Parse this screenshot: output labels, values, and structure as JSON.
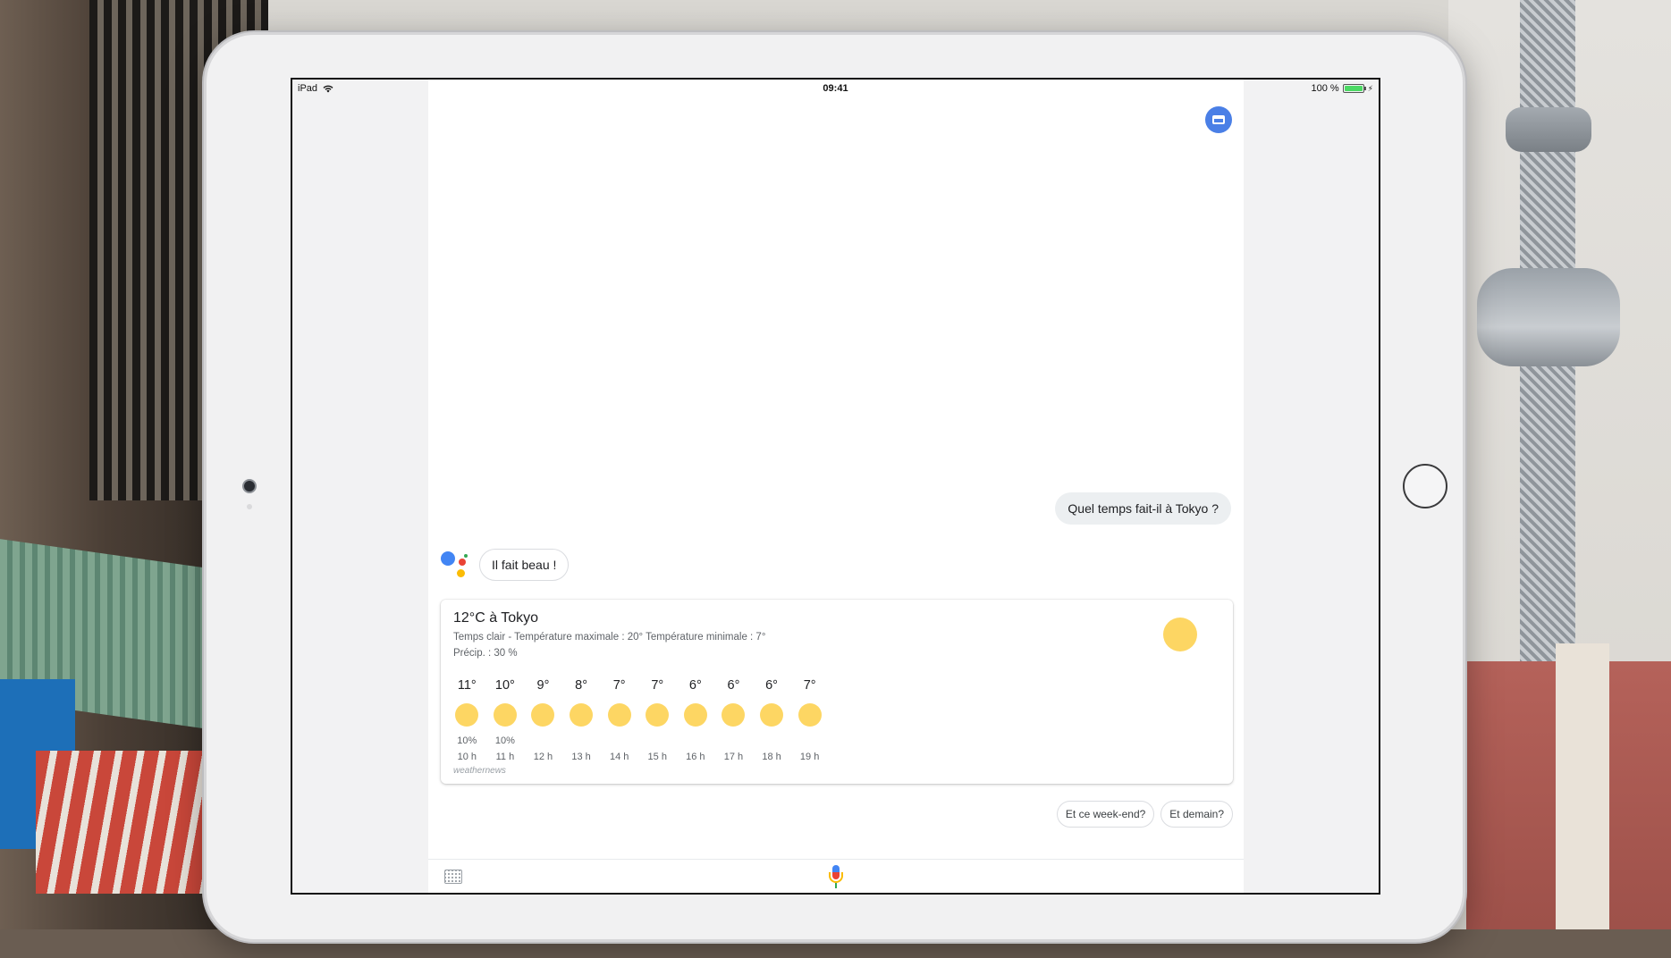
{
  "statusbar": {
    "device": "iPad",
    "time": "09:41",
    "battery": "100 %"
  },
  "conversation": {
    "user_query": "Quel temps fait-il à Tokyo ?",
    "assistant_reply": "Il fait beau !"
  },
  "weather": {
    "title": "12°C à Tokyo",
    "description": "Temps clair - Température maximale : 20° Température minimale : 7°",
    "precipitation": "Précip. : 30 %",
    "source": "weathernews",
    "hourly": [
      {
        "temp": "11°",
        "precip": "10%",
        "time": "10 h"
      },
      {
        "temp": "10°",
        "precip": "10%",
        "time": "11 h"
      },
      {
        "temp": "9°",
        "precip": "",
        "time": "12 h"
      },
      {
        "temp": "8°",
        "precip": "",
        "time": "13 h"
      },
      {
        "temp": "7°",
        "precip": "",
        "time": "14 h"
      },
      {
        "temp": "7°",
        "precip": "",
        "time": "15 h"
      },
      {
        "temp": "6°",
        "precip": "",
        "time": "16 h"
      },
      {
        "temp": "6°",
        "precip": "",
        "time": "17 h"
      },
      {
        "temp": "6°",
        "precip": "",
        "time": "18 h"
      },
      {
        "temp": "7°",
        "precip": "",
        "time": "19 h"
      }
    ]
  },
  "suggestions": [
    "Et ce week-end?",
    "Et demain?"
  ],
  "icons": {
    "top_right": "inbox-icon",
    "keyboard": "keyboard-icon",
    "mic": "mic-icon",
    "weather": "sun-icon",
    "assistant": "google-assistant-logo"
  },
  "colors": {
    "sun": "#fdd663",
    "assistant_blue": "#4285f4",
    "bubble_user": "#eceff1"
  }
}
